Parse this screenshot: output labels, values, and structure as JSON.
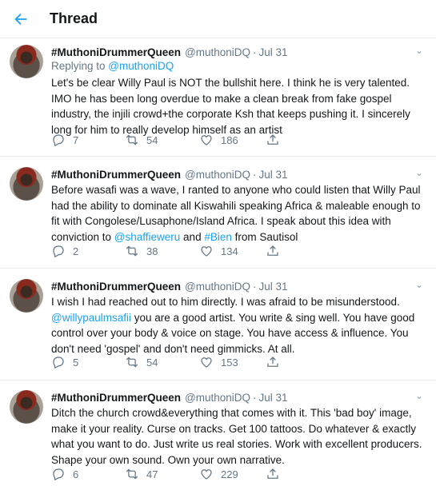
{
  "header": {
    "title": "Thread"
  },
  "tweets": [
    {
      "name": "#MuthoniDrummerQueen",
      "handle": "@muthoniDQ",
      "dot": "·",
      "date": "Jul 31",
      "reply_prefix": "Replying to ",
      "reply_to": "@muthoniDQ",
      "lines": [
        "Let's be clear Willy Paul is NOT the bullshit here. I think he is very talented.",
        "IMO he has been long overdue to make a clean break from fake gospel",
        "industry, the injili crowd+the corporate Ksh that keeps pushing it. I sincerely",
        "long for him to really develop himself as an artist"
      ],
      "replies": "7",
      "retweets": "54",
      "likes": "186"
    },
    {
      "name": "#MuthoniDrummerQueen",
      "handle": "@muthoniDQ",
      "dot": "·",
      "date": "Jul 31",
      "lines": [
        "Before wasafi was a wave, I ranted to anyone who could listen that Willy Paul",
        "had the ability to dominate all Kiswahili speaking Africa & maleable enough to",
        "fit with Congolese/Lusaphone/Island Africa. I speak about this idea with"
      ],
      "line4_a": "conviction to ",
      "line4_mention": "@shaffieweru",
      "line4_b": " and ",
      "line4_hashtag": "#Bien",
      "line4_c": " from Sautisol",
      "replies": "2",
      "retweets": "38",
      "likes": "134"
    },
    {
      "name": "#MuthoniDrummerQueen",
      "handle": "@muthoniDQ",
      "dot": "·",
      "date": "Jul 31",
      "line1": "I wish I had reached out to him directly. I was afraid to be misunderstood.",
      "line2_mention": "@willypaulmsafii",
      "line2_rest": " you are a good artist. You write & sing well. You have good",
      "lines": [
        "control over your body & voice on stage. You have access & influence. You",
        "don't need 'gospel' and don't need gimmicks. At all."
      ],
      "replies": "5",
      "retweets": "54",
      "likes": "153"
    },
    {
      "name": "#MuthoniDrummerQueen",
      "handle": "@muthoniDQ",
      "dot": "·",
      "date": "Jul 31",
      "lines": [
        "Ditch the church crowd&everything that comes with it. This 'bad boy' image,",
        "make it your reality. Curse on tracks. Get 100 tattoos. Do whatever & exactly",
        "what you want to do. Just write us real stories. Work with excellent producers.",
        "Shape your own sound. Own your own narrative."
      ],
      "replies": "6",
      "retweets": "47",
      "likes": "229"
    }
  ]
}
